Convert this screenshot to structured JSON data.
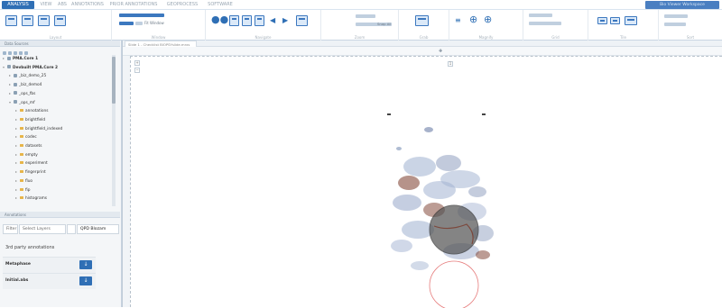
{
  "top_tabs": [
    {
      "label": "ANALYSIS",
      "active": true
    },
    {
      "label": "VIEW",
      "active": false
    },
    {
      "label": "ABS",
      "active": false
    },
    {
      "label": "ANNOTATIONS",
      "active": false
    },
    {
      "label": "PRIOR ANNOTATIONS",
      "active": false
    },
    {
      "label": "GEOPROCESS",
      "active": false
    },
    {
      "label": "SOFTWARE",
      "active": false
    }
  ],
  "app_badge": "Bio Viewer Workspace",
  "ribbon_groups": [
    "Layout",
    "Window",
    "Navigate",
    "Zoom",
    "Grab",
    "Magnify",
    "Grid",
    "Tile",
    "Sort"
  ],
  "ribbon_small_labels": {
    "fit_button": "Fit Window",
    "snap_option": "Snap All"
  },
  "data_sources": {
    "title": "Data Sources",
    "tree": [
      {
        "label": "PMA.Core 1",
        "level": 0,
        "kind": "db",
        "expanded": false,
        "bold": true
      },
      {
        "label": "Devbuilt PMA.Core 2",
        "level": 0,
        "kind": "db",
        "expanded": true,
        "bold": true
      },
      {
        "label": "_biz_demo_25",
        "level": 1,
        "kind": "db",
        "expanded": false,
        "bold": false
      },
      {
        "label": "_biz_demo4",
        "level": 1,
        "kind": "db",
        "expanded": false,
        "bold": false
      },
      {
        "label": "_ops_fbs",
        "level": 1,
        "kind": "db",
        "expanded": false,
        "bold": false
      },
      {
        "label": "_ops_mf",
        "level": 1,
        "kind": "db",
        "expanded": true,
        "bold": false
      },
      {
        "label": "annotations",
        "level": 2,
        "kind": "folder",
        "expanded": false,
        "bold": false
      },
      {
        "label": "brightfield",
        "level": 2,
        "kind": "folder",
        "expanded": false,
        "bold": false
      },
      {
        "label": "brightfield_indexed",
        "level": 2,
        "kind": "folder",
        "expanded": false,
        "bold": false
      },
      {
        "label": "codec",
        "level": 2,
        "kind": "folder",
        "expanded": false,
        "bold": false
      },
      {
        "label": "datasets",
        "level": 2,
        "kind": "folder",
        "expanded": false,
        "bold": false
      },
      {
        "label": "empty",
        "level": 2,
        "kind": "folder",
        "expanded": false,
        "bold": false
      },
      {
        "label": "experiment",
        "level": 2,
        "kind": "folder",
        "expanded": false,
        "bold": false
      },
      {
        "label": "fingerprint",
        "level": 2,
        "kind": "folder",
        "expanded": false,
        "bold": false
      },
      {
        "label": "fluo",
        "level": 2,
        "kind": "folder",
        "expanded": false,
        "bold": false
      },
      {
        "label": "fip",
        "level": 2,
        "kind": "folder",
        "expanded": false,
        "bold": false
      },
      {
        "label": "histograms",
        "level": 2,
        "kind": "folder",
        "expanded": false,
        "bold": false
      }
    ]
  },
  "annotations_panel": {
    "title": "Annotations",
    "filter_label": "Filter",
    "filter_placeholder": "Select Layers",
    "filter_value": "QPD Blozam",
    "section_title": "3rd party annotations",
    "rows": [
      {
        "label": "Metaphase",
        "button": "↓"
      },
      {
        "label": "Initial.abs",
        "button": "↓"
      }
    ]
  },
  "viewer": {
    "tab_label": "Slide 1 - Checklist BIOPSYslide.mrxs",
    "page_marker": "1"
  },
  "colors": {
    "accent": "#2f6fb5",
    "tissue_dark": "#7a3a2a",
    "tissue_light": "#9eb0cf",
    "magnifier": "#555555",
    "selection_circle": "#e05b5b"
  }
}
